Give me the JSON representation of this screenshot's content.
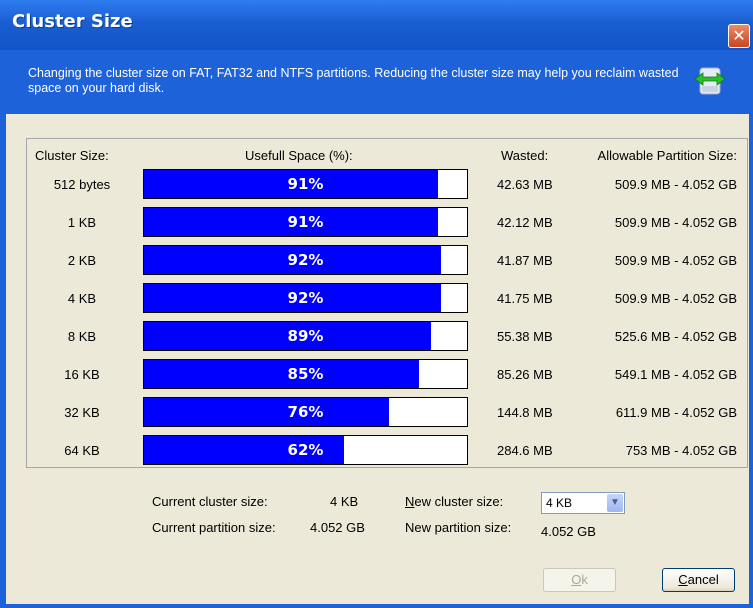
{
  "window": {
    "title": "Cluster Size",
    "close_label": "✕"
  },
  "banner": {
    "description": "Changing the cluster size on FAT, FAT32 and NTFS partitions. Reducing the cluster size may help you reclaim wasted space on your hard disk.",
    "icon": "disk-convert-icon"
  },
  "table": {
    "headers": {
      "cluster_size": "Cluster Size:",
      "useful_space": "Usefull Space (%):",
      "wasted": "Wasted:",
      "allowable": "Allowable Partition Size:"
    },
    "rows": [
      {
        "size": "512 bytes",
        "useful_pct": 91,
        "label": "91%",
        "wasted": "42.63 MB",
        "allowable": "509.9 MB - 4.052 GB"
      },
      {
        "size": "1 KB",
        "useful_pct": 91,
        "label": "91%",
        "wasted": "42.12 MB",
        "allowable": "509.9 MB - 4.052 GB"
      },
      {
        "size": "2 KB",
        "useful_pct": 92,
        "label": "92%",
        "wasted": "41.87 MB",
        "allowable": "509.9 MB - 4.052 GB"
      },
      {
        "size": "4 KB",
        "useful_pct": 92,
        "label": "92%",
        "wasted": "41.75 MB",
        "allowable": "509.9 MB - 4.052 GB"
      },
      {
        "size": "8 KB",
        "useful_pct": 89,
        "label": "89%",
        "wasted": "55.38 MB",
        "allowable": "525.6 MB - 4.052 GB"
      },
      {
        "size": "16 KB",
        "useful_pct": 85,
        "label": "85%",
        "wasted": "85.26 MB",
        "allowable": "549.1 MB - 4.052 GB"
      },
      {
        "size": "32 KB",
        "useful_pct": 76,
        "label": "76%",
        "wasted": "144.8 MB",
        "allowable": "611.9 MB - 4.052 GB"
      },
      {
        "size": "64 KB",
        "useful_pct": 62,
        "label": "62%",
        "wasted": "284.6 MB",
        "allowable": "753 MB - 4.052 GB"
      }
    ]
  },
  "info": {
    "current_cluster_label": "Current cluster size:",
    "current_cluster_value": "4 KB",
    "current_partition_label": "Current partition size:",
    "current_partition_value": "4.052 GB",
    "new_cluster_label_pre": "N",
    "new_cluster_label_post": "ew cluster size:",
    "new_cluster_value": "4 KB",
    "new_partition_label": "New partition size:",
    "new_partition_value": "4.052 GB"
  },
  "buttons": {
    "ok_pre": "O",
    "ok_post": "k",
    "cancel_pre": "C",
    "cancel_post": "ancel"
  },
  "colors": {
    "bar_fill": "#0000ff",
    "title_bar": "#1d62d8"
  }
}
